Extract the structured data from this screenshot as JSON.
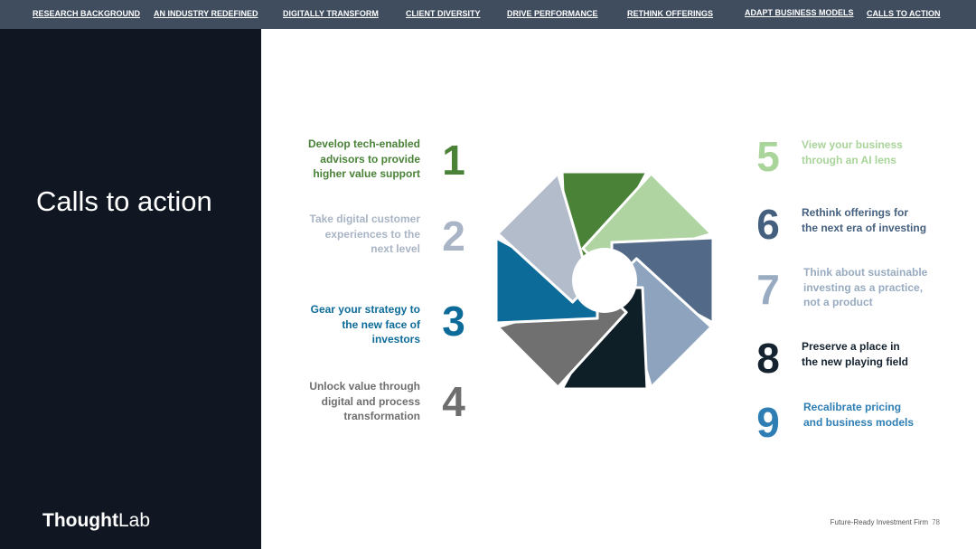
{
  "nav": [
    {
      "label": "RESEARCH BACKGROUND"
    },
    {
      "label": "AN INDUSTRY REDEFINED"
    },
    {
      "label": "DIGITALLY TRANSFORM"
    },
    {
      "label": "CLIENT DIVERSITY"
    },
    {
      "label": "DRIVE PERFORMANCE"
    },
    {
      "label": "RETHINK OFFERINGS"
    },
    {
      "label": "ADAPT BUSINESS MODELS"
    },
    {
      "label": "CALLS TO ACTION"
    }
  ],
  "sidebar": {
    "title": "Calls to action",
    "logo_bold": "Thought",
    "logo_light": "Lab"
  },
  "items": [
    {
      "number": "1",
      "text": "Develop tech-enabled\nadvisors to provide\nhigher value support",
      "color": "#4a8238"
    },
    {
      "number": "2",
      "text": "Take digital customer\nexperiences to the\nnext level",
      "color": "#a9b5c6"
    },
    {
      "number": "3",
      "text": "Gear your strategy to\nthe new face of\ninvestors",
      "color": "#0d6b99"
    },
    {
      "number": "4",
      "text": "Unlock value through\ndigital and process\ntransformation",
      "color": "#6e6e6e"
    },
    {
      "number": "5",
      "text": "View your business\nthrough an AI lens",
      "color": "#a9d49a"
    },
    {
      "number": "6",
      "text": "Rethink offerings for\nthe next era of investing",
      "color": "#45607f"
    },
    {
      "number": "7",
      "text": "Think about sustainable\ninvesting as a practice,\nnot a product",
      "color": "#98abc0"
    },
    {
      "number": "8",
      "text": "Preserve a place in\nthe new playing field",
      "color": "#152330"
    },
    {
      "number": "9",
      "text": "Recalibrate pricing\nand business models",
      "color": "#2e7eb4"
    }
  ],
  "wheel_colors": [
    "#4a8238",
    "#afd3a1",
    "#526988",
    "#8ea3bd",
    "#0f1f28",
    "#707070",
    "#0d6b99",
    "#b3bccb"
  ],
  "footer": {
    "label": "Future-Ready Investment Firm",
    "page": "78"
  }
}
